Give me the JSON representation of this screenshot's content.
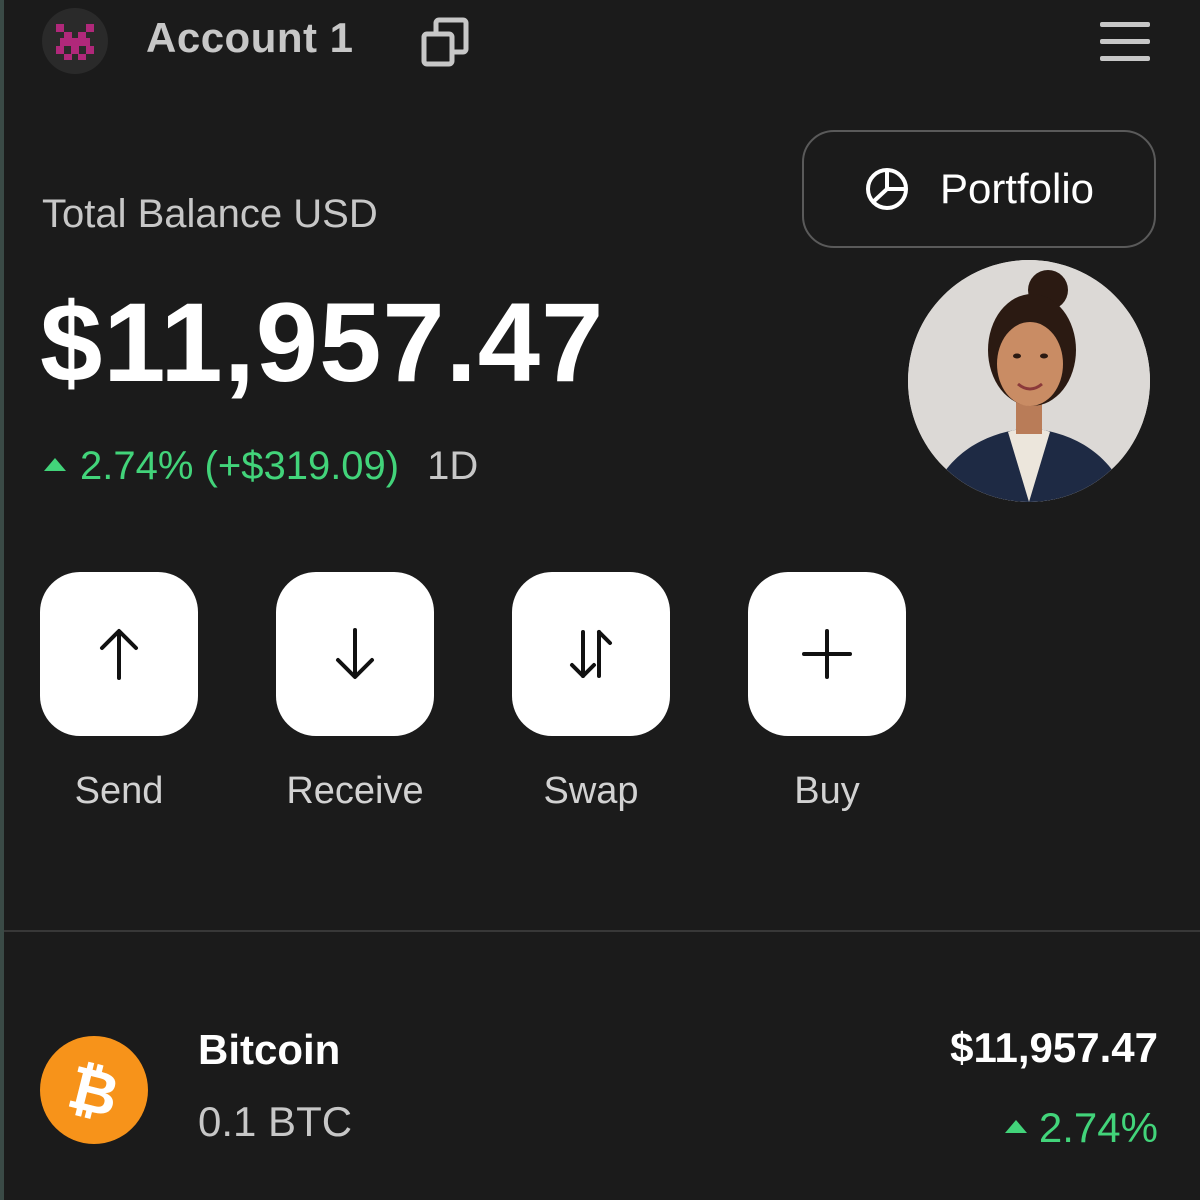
{
  "header": {
    "account_name": "Account 1",
    "avatar_icon": "pixel-identicon",
    "copy_icon": "copy-icon",
    "menu_icon": "hamburger-menu-icon"
  },
  "balance": {
    "label": "Total Balance USD",
    "value": "$11,957.47",
    "change": "2.74% (+$319.09)",
    "period": "1D",
    "change_direction": "up"
  },
  "portfolio_button": {
    "label": "Portfolio",
    "icon": "pie-chart-icon"
  },
  "profile": {
    "icon": "profile-photo"
  },
  "actions": [
    {
      "label": "Send",
      "icon": "arrow-up-icon"
    },
    {
      "label": "Receive",
      "icon": "arrow-down-icon"
    },
    {
      "label": "Swap",
      "icon": "swap-icon"
    },
    {
      "label": "Buy",
      "icon": "plus-icon"
    }
  ],
  "assets": [
    {
      "name": "Bitcoin",
      "amount": "0.1 BTC",
      "value": "$11,957.47",
      "change": "2.74%",
      "icon": "bitcoin-icon"
    }
  ],
  "colors": {
    "background": "#1b1b1b",
    "positive": "#42d47a",
    "bitcoin": "#f7931a",
    "identicon": "#b0287a"
  }
}
